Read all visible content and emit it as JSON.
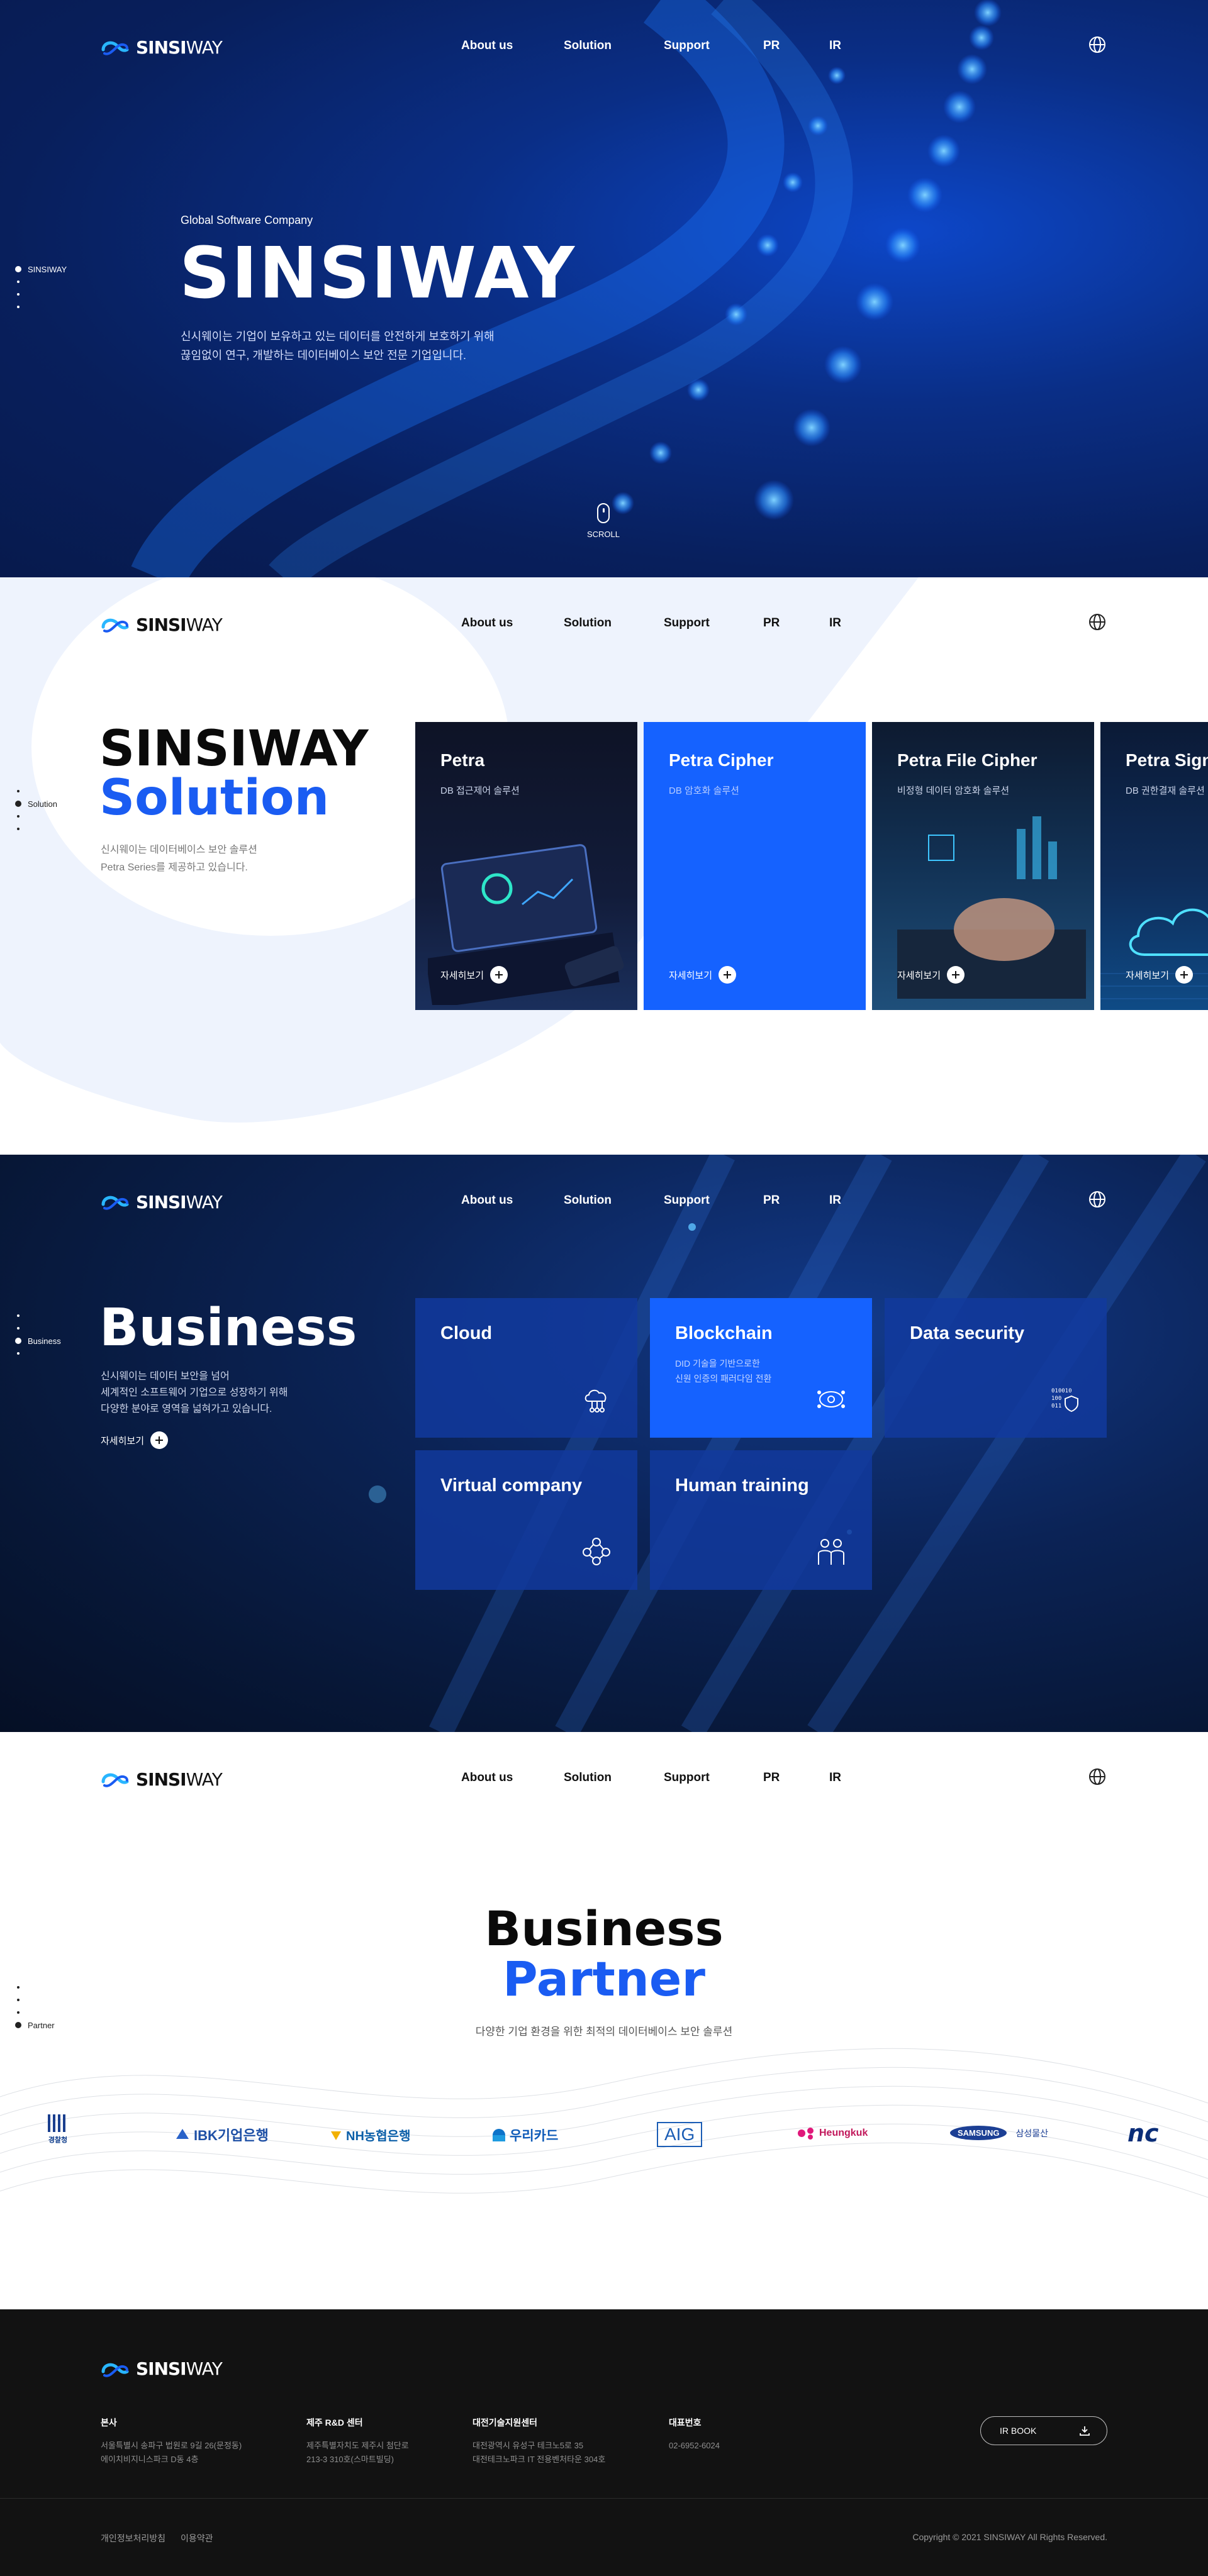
{
  "brand": {
    "name_bold": "SINSI",
    "name_light": "WAY",
    "accent": "#1a5cf2"
  },
  "nav": {
    "items": [
      "About us",
      "Solution",
      "Support",
      "PR",
      "IR"
    ]
  },
  "hero": {
    "eyebrow": "Global Software Company",
    "title": "SINSIWAY",
    "desc_line1": "신시웨이는 기업이 보유하고 있는 데이터를 안전하게 보호하기 위해",
    "desc_line2": "끊임없이 연구, 개발하는 데이터베이스 보안 전문 기업입니다.",
    "side_label": "SINSIWAY",
    "scroll": "SCROLL"
  },
  "solution": {
    "title1": "SINSIWAY",
    "title2": "Solution",
    "desc_line1": "신시웨이는 데이터베이스 보안 솔루션",
    "desc_line2": "Petra Series를 제공하고 있습니다.",
    "side_label": "Solution",
    "more": "자세히보기",
    "cards": [
      {
        "title": "Petra",
        "sub": "DB 접근제어 솔루션"
      },
      {
        "title": "Petra Cipher",
        "sub": "DB 암호화 솔루션"
      },
      {
        "title": "Petra File Cipher",
        "sub": "비정형 데이터 암호화 솔루션"
      },
      {
        "title": "Petra Signer",
        "sub": "DB 권한결재 솔루션"
      }
    ]
  },
  "business": {
    "title": "Business",
    "desc_line1": "신시웨이는 데이터 보안을 넘어",
    "desc_line2": "세계적인 소프트웨어 기업으로 성장하기 위해",
    "desc_line3": "다양한 분야로 영역을 넓혀가고 있습니다.",
    "more": "자세히보기",
    "side_label": "Business",
    "cards": [
      {
        "title": "Cloud",
        "icon": "cloud-icon"
      },
      {
        "title": "Blockchain",
        "sub_line1": "DID 기술을 기반으로한",
        "sub_line2": "신원 인증의 패러다임 전환",
        "icon": "blockchain-icon"
      },
      {
        "title": "Data security",
        "icon": "data-security-icon"
      },
      {
        "title": "Virtual company",
        "icon": "network-icon"
      },
      {
        "title": "Human training",
        "icon": "people-icon"
      }
    ]
  },
  "partner": {
    "title1": "Business",
    "title2": "Partner",
    "desc": "다양한 기업 환경을 위한 최적의 데이터베이스 보안 솔루션",
    "side_label": "Partner",
    "logos": [
      "경찰청",
      "IBK기업은행",
      "NH농협은행",
      "우리카드",
      "AIG",
      "Heungkuk",
      "SAMSUNG",
      "삼성물산",
      "nc"
    ]
  },
  "footer": {
    "col1": {
      "title": "본사",
      "line1": "서울특별시 송파구 법원로 9길 26(문정동)",
      "line2": "에이치비지니스파크 D동 4층"
    },
    "col2": {
      "title": "제주 R&D 센터",
      "line1": "제주특별자치도 제주시 첨단로",
      "line2": "213-3 310호(스마트빌딩)"
    },
    "col3": {
      "title": "대전기술지원센터",
      "line1": "대전광역시 유성구 테크노5로 35",
      "line2": "대전테크노파크 IT 전용벤처타운 304호"
    },
    "col4": {
      "title": "대표번호",
      "line1": "02-6952-6024"
    },
    "irbook": "IR BOOK",
    "link1": "개인정보처리방침",
    "link2": "이용약관",
    "copyright": "Copyright © 2021 SINSIWAY All Rights Reserved."
  }
}
